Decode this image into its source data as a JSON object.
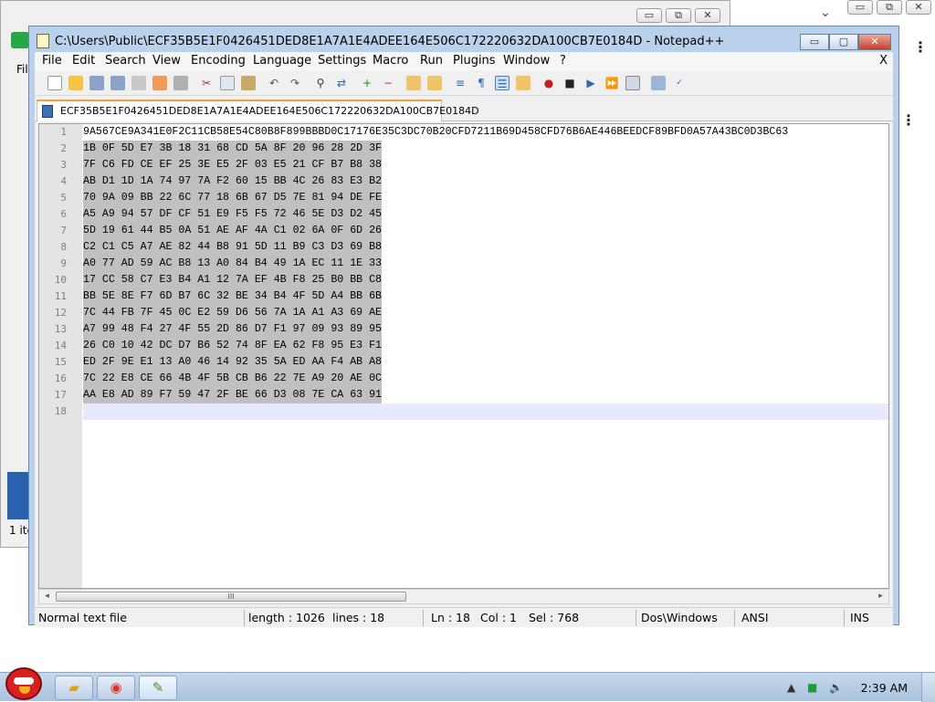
{
  "background_window": {
    "menu_fragment": "Fil",
    "status_fragment": "1 ite"
  },
  "background_window_controls": [
    "▭",
    "⧉",
    "✕"
  ],
  "notepad": {
    "title": "C:\\Users\\Public\\ECF35B5E1F0426451DED8E1A7A1E4ADEE164E506C172220632DA100CB7E0184D - Notepad++",
    "window_controls": {
      "minimize": "▭",
      "maximize": "▢",
      "close": "✕"
    },
    "menu": [
      "File",
      "Edit",
      "Search",
      "View",
      "Encoding",
      "Language",
      "Settings",
      "Macro",
      "Run",
      "Plugins",
      "Window",
      "?"
    ],
    "menu_close": "X",
    "tab_label": "ECF35B5E1F0426451DED8E1A7A1E4ADEE164E506C172220632DA100CB7E0184D",
    "line_numbers": [
      "1",
      "2",
      "3",
      "4",
      "5",
      "6",
      "7",
      "8",
      "9",
      "10",
      "11",
      "12",
      "13",
      "14",
      "15",
      "16",
      "17",
      "18"
    ],
    "lines": [
      "9A567CE9A341E0F2C11CB58E54C80B8F899BBBD0C17176E35C3DC70B20CFD7211B69D458CFD76B6AE446BEEDCF89BFD0A57A43BC0D3BC63",
      "1B 0F 5D E7 3B 18 31 68 CD 5A 8F 20 96 28 2D 3F",
      "7F C6 FD CE EF 25 3E E5 2F 03 E5 21 CF B7 B8 38",
      "AB D1 1D 1A 74 97 7A F2 60 15 BB 4C 26 83 E3 B2",
      "70 9A 09 BB 22 6C 77 18 6B 67 D5 7E 81 94 DE FE",
      "A5 A9 94 57 DF CF 51 E9 F5 F5 72 46 5E D3 D2 45",
      "5D 19 61 44 B5 0A 51 AE AF 4A C1 02 6A 0F 6D 26",
      "C2 C1 C5 A7 AE 82 44 B8 91 5D 11 B9 C3 D3 69 B8",
      "A0 77 AD 59 AC B8 13 A0 84 B4 49 1A EC 11 1E 33",
      "17 CC 58 C7 E3 B4 A1 12 7A EF 4B F8 25 B0 BB C8",
      "BB 5E 8E F7 6D B7 6C 32 BE 34 B4 4F 5D A4 BB 6B",
      "7C 44 FB 7F 45 0C E2 59 D6 56 7A 1A A1 A3 69 AE",
      "A7 99 48 F4 27 4F 55 2D 86 D7 F1 97 09 93 89 95",
      "26 C0 10 42 DC D7 B6 52 74 8F EA 62 F8 95 E3 F1",
      "ED 2F 9E E1 13 A0 46 14 92 35 5A ED AA F4 AB A8",
      "7C 22 E8 CE 66 4B 4F 5B CB B6 22 7E A9 20 AE 0C",
      "AA E8 AD 89 F7 59 47 2F BE 66 D3 08 7E CA 63 91",
      ""
    ],
    "scroll_thumb_grip": "III",
    "scroll_left": "◂",
    "scroll_right": "▸",
    "status": {
      "file_type": "Normal text file",
      "length": "length : 1026",
      "lines": "lines : 18",
      "ln": "Ln : 18",
      "col": "Col : 1",
      "sel": "Sel : 768",
      "eol": "Dos\\Windows",
      "encoding": "ANSI",
      "mode": "INS"
    }
  },
  "taskbar": {
    "clock": "2:39 AM",
    "tray_arrow": "▲"
  },
  "colors": {
    "frame": "#b9d1ea",
    "selection": "#c0c0c0",
    "current_line": "#e8e8ff",
    "tab_accent": "#f3a13e",
    "close_button": "#c4412b",
    "taskbar": "#b3cae2"
  }
}
